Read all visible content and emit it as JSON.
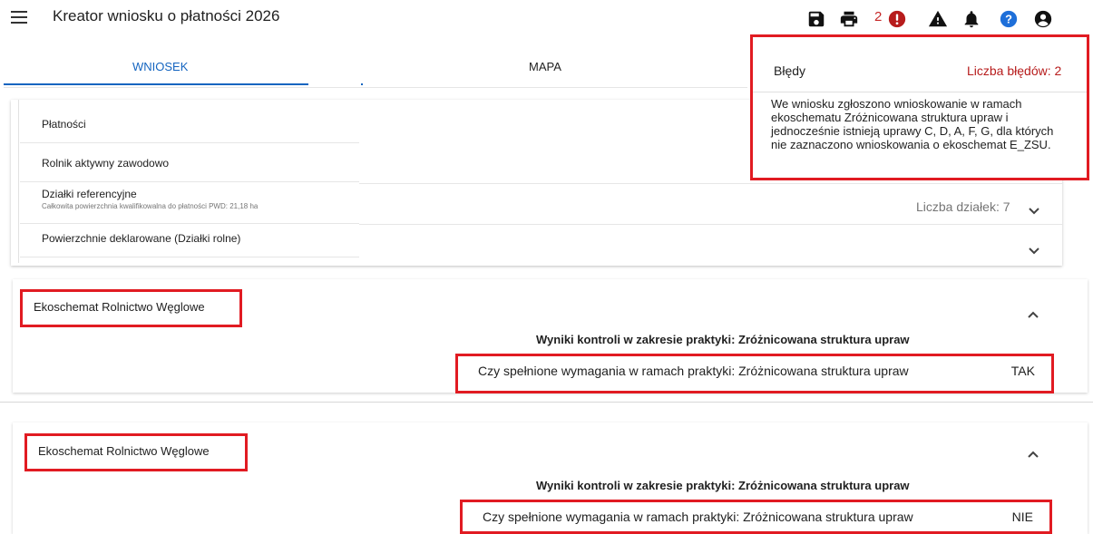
{
  "header": {
    "title": "Kreator wniosku o płatności 2026",
    "error_count": "2",
    "icons": [
      "menu-icon",
      "save-icon",
      "print-icon",
      "error-icon",
      "warning-icon",
      "bell-icon",
      "help-icon",
      "account-icon"
    ]
  },
  "tabs": [
    {
      "label": "WNIOSEK",
      "active": true
    },
    {
      "label": "MAPA",
      "active": false
    }
  ],
  "nav": {
    "items": [
      {
        "label": "Płatności"
      },
      {
        "label": "Rolnik aktywny zawodowo"
      },
      {
        "label": "Działki referencyjne",
        "sublabel": "Całkowita powierzchnia kwalifikowalna do płatności PWD: 21,18 ha"
      },
      {
        "label": "Powierzchnie deklarowane (Działki rolne)"
      }
    ],
    "dzialki_count": "Liczba działek: 7"
  },
  "errors_popup": {
    "title": "Błędy",
    "count_label": "Liczba błędów: 2",
    "message": "We wniosku zgłoszono wnioskowanie w ramach ekoschematu Zróżnicowana struktura upraw i jednocześnie istnieją uprawy C, D, A, F, G, dla których nie zaznaczono wnioskowania o ekoschemat E_ZSU."
  },
  "sections": [
    {
      "title": "Ekoschemat Rolnictwo Węglowe",
      "heading": "Wyniki kontroli w zakresie praktyki: Zróżnicowana struktura upraw",
      "requirement_label": "Czy spełnione wymagania w ramach praktyki: Zróżnicowana struktura upraw",
      "requirement_value": "TAK"
    },
    {
      "title": "Ekoschemat Rolnictwo Węglowe",
      "heading": "Wyniki kontroli w zakresie praktyki: Zróżnicowana struktura upraw",
      "requirement_label": "Czy spełnione wymagania w ramach praktyki: Zróżnicowana struktura upraw",
      "requirement_value": "NIE"
    }
  ],
  "colors": {
    "accent": "#1565c0",
    "highlight_border": "#e11b22",
    "error": "#b71c1c"
  }
}
